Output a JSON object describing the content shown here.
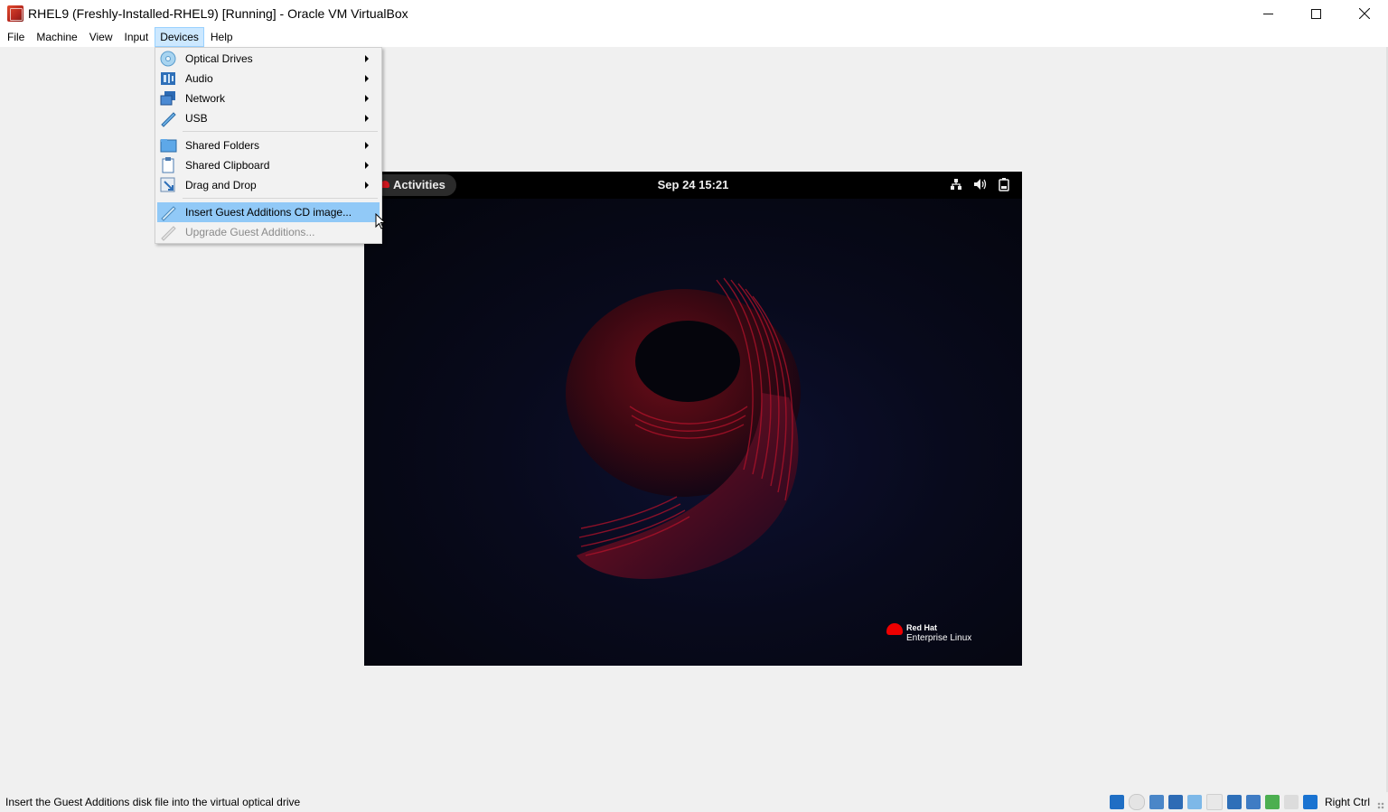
{
  "window": {
    "title": "RHEL9 (Freshly-Installed-RHEL9) [Running] - Oracle VM VirtualBox",
    "controls": [
      "minimize-icon",
      "maximize-icon",
      "close-icon"
    ]
  },
  "menubar": {
    "items": [
      {
        "label": "File"
      },
      {
        "label": "Machine"
      },
      {
        "label": "View"
      },
      {
        "label": "Input"
      },
      {
        "label": "Devices",
        "active": true
      },
      {
        "label": "Help"
      }
    ]
  },
  "devices_menu": {
    "items": [
      {
        "label": "Optical Drives",
        "icon": "optical-drive-icon",
        "submenu": true
      },
      {
        "label": "Audio",
        "icon": "audio-icon",
        "submenu": true
      },
      {
        "label": "Network",
        "icon": "network-icon",
        "submenu": true
      },
      {
        "label": "USB",
        "icon": "usb-icon",
        "submenu": true
      },
      {
        "label": "Shared Folders",
        "icon": "shared-folders-icon",
        "submenu": true
      },
      {
        "label": "Shared Clipboard",
        "icon": "clipboard-icon",
        "submenu": true
      },
      {
        "label": "Drag and Drop",
        "icon": "drag-drop-icon",
        "submenu": true
      },
      {
        "label": "Insert Guest Additions CD image...",
        "icon": "guest-additions-icon",
        "highlighted": true
      },
      {
        "label": "Upgrade Guest Additions...",
        "icon": "upgrade-icon",
        "disabled": true
      }
    ]
  },
  "guest": {
    "activities_label": "Activities",
    "clock": "Sep 24  15:21",
    "tray_icons": [
      "network-wired-icon",
      "volume-icon",
      "battery-icon"
    ],
    "logo_line1": "Red Hat",
    "logo_line2": "Enterprise Linux",
    "wallpaper_mark": "9"
  },
  "statusbar": {
    "text": "Insert the Guest Additions disk file into the virtual optical drive",
    "host_key": "Right Ctrl"
  },
  "colors": {
    "menu_highlight": "#91c9f7",
    "menubar_active": "#cce8ff",
    "rhel_red": "#ee0000"
  }
}
